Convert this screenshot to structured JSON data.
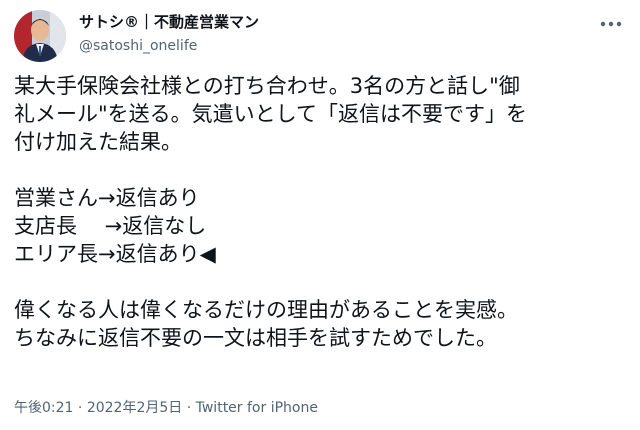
{
  "user": {
    "display_name": "サトシ®｜不動産営業マン",
    "handle": "@satoshi_onelife"
  },
  "tweet": {
    "lines": [
      "某大手保険会社様との打ち合わせ。3名の方と話し\"御",
      "礼メール\"を送る。気遣いとして「返信は不要です」を",
      "付け加えた結果。",
      "",
      "営業さん→返信あり",
      "支店長　 →返信なし",
      "エリア長→返信あり◀",
      "",
      "偉くなる人は偉くなるだけの理由があることを実感。",
      "ちなみに返信不要の一文は相手を試すためでした。"
    ]
  },
  "meta": {
    "time": "午後0:21",
    "separator": " · ",
    "date": "2022年2月5日",
    "separator2": " · ",
    "source": "Twitter for iPhone"
  },
  "icons": {
    "more": "more-dots-icon",
    "avatar": "profile-avatar"
  },
  "colors": {
    "text": "#0f1419",
    "secondary": "#536471"
  }
}
